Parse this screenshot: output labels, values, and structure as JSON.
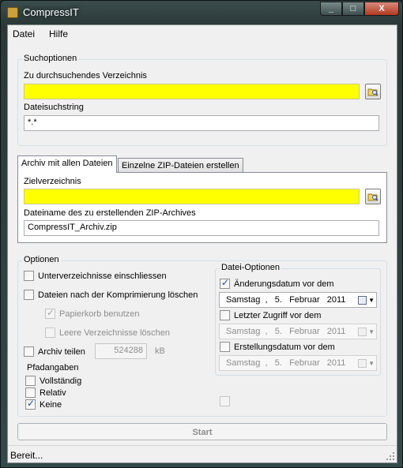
{
  "window": {
    "title": "CompressIT",
    "minimize_glyph": "_",
    "maximize_glyph": "□",
    "close_glyph": "X"
  },
  "menu": {
    "items": [
      {
        "label": "Datei"
      },
      {
        "label": "Hilfe"
      }
    ]
  },
  "search_options": {
    "group_label": "Suchoptionen",
    "directory_label": "Zu durchsuchendes Verzeichnis",
    "directory_value": "",
    "search_string_label": "Dateisuchstring",
    "search_string_value": "*.*"
  },
  "tabs": [
    {
      "label": "Archiv mit allen Dateien",
      "active": true
    },
    {
      "label": "Einzelne ZIP-Dateien erstellen",
      "active": false
    }
  ],
  "archive_tab": {
    "target_dir_label": "Zielverzeichnis",
    "target_dir_value": "",
    "archive_name_label": "Dateiname des zu erstellenden ZIP-Archives",
    "archive_name_value": "CompressIT_Archiv.zip"
  },
  "options": {
    "group_label": "Optionen",
    "include_subdirs": {
      "label": "Unterverzeichnisse einschliessen",
      "checked": false
    },
    "delete_after": {
      "label": "Dateien nach der Komprimierung löschen",
      "checked": false
    },
    "use_recycle": {
      "label": "Papierkorb benutzen",
      "checked": true,
      "enabled": false
    },
    "delete_empty_dirs": {
      "label": "Leere Verzeichnisse löschen",
      "checked": false,
      "enabled": false
    },
    "split_archive": {
      "label": "Archiv teilen",
      "checked": false
    },
    "split_size_value": "524288",
    "split_size_unit": "kB",
    "path_info_label": "Pfadangaben",
    "path_full": {
      "label": "Vollständig",
      "checked": false
    },
    "path_relative": {
      "label": "Relativ",
      "checked": false
    },
    "path_none": {
      "label": "Keine",
      "checked": true
    }
  },
  "file_options": {
    "group_label": "Datei-Optionen",
    "modified_before": {
      "label": "Änderungsdatum vor dem",
      "checked": true,
      "date": "Samstag  ,   5.   Februar   2011"
    },
    "accessed_before": {
      "label": "Letzter Zugriff vor dem",
      "checked": false,
      "date": "Samstag  ,   5.   Februar   2011"
    },
    "created_before": {
      "label": "Erstellungsdatum vor dem",
      "checked": false,
      "date": "Samstag  ,   5.   Februar   2011"
    }
  },
  "checkmark_glyph": "✓",
  "start_button": {
    "label": "Start",
    "enabled": false
  },
  "status": {
    "text": "Bereit..."
  }
}
